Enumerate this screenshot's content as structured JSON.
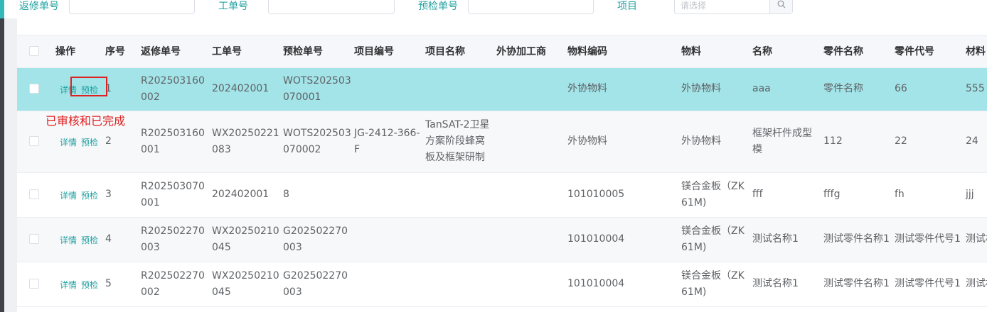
{
  "filters": {
    "rework_no_label": "返修单号",
    "work_order_label": "工单号",
    "precheck_no_label": "预检单号",
    "project_label": "项目",
    "project_placeholder": "请选择"
  },
  "table": {
    "columns": [
      "操作",
      "序号",
      "返修单号",
      "工单号",
      "预检单号",
      "项目编号",
      "项目名称",
      "外协加工商",
      "物料编码",
      "物料",
      "名称",
      "零件名称",
      "零件代号",
      "材料"
    ],
    "action_detail": "详情",
    "action_precheck": "预检",
    "rows": [
      {
        "index": "1",
        "rework_no": "R202503160002",
        "work_order": "202402001",
        "precheck_no": "WOTS202503070001",
        "project_code": "",
        "project_name": "",
        "vendor": "",
        "material_code": "外协物料",
        "material": "外协物料",
        "name": "aaa",
        "part_name": "零件名称",
        "part_code": "66",
        "material2": "555"
      },
      {
        "index": "2",
        "rework_no": "R202503160001",
        "work_order": "WX20250221083",
        "precheck_no": "WOTS202503070002",
        "project_code": "JG-2412-366-F",
        "project_name": "TanSAT-2卫星方案阶段蜂窝板及框架研制",
        "vendor": "",
        "material_code": "外协物料",
        "material": "外协物料",
        "name": "框架杆件成型模",
        "part_name": "112",
        "part_code": "22",
        "material2": "24"
      },
      {
        "index": "3",
        "rework_no": "R202503070001",
        "work_order": "202402001",
        "precheck_no": "8",
        "project_code": "",
        "project_name": "",
        "vendor": "",
        "material_code": "101010005",
        "material": "镁合金板（ZK61M)",
        "name": "fff",
        "part_name": "fffg",
        "part_code": "fh",
        "material2": "jjj"
      },
      {
        "index": "4",
        "rework_no": "R202502270003",
        "work_order": "WX20250210045",
        "precheck_no": "G202502270003",
        "project_code": "",
        "project_name": "",
        "vendor": "",
        "material_code": "101010004",
        "material": "镁合金板（ZK61M)",
        "name": "测试名称1",
        "part_name": "测试零件名称1",
        "part_code": "测试零件代号1",
        "material2": "测试材"
      },
      {
        "index": "5",
        "rework_no": "R202502270002",
        "work_order": "WX20250210045",
        "precheck_no": "G202502270003",
        "project_code": "",
        "project_name": "",
        "vendor": "",
        "material_code": "101010004",
        "material": "镁合金板（ZK61M)",
        "name": "测试名称1",
        "part_name": "测试零件名称1",
        "part_code": "测试零件代号1",
        "material2": "测试材"
      }
    ]
  },
  "annotation": "已审核和已完成",
  "colors": {
    "accent": "#20a0a0",
    "selected_row": "#a2e4e8",
    "annotation_red": "#e02020"
  }
}
